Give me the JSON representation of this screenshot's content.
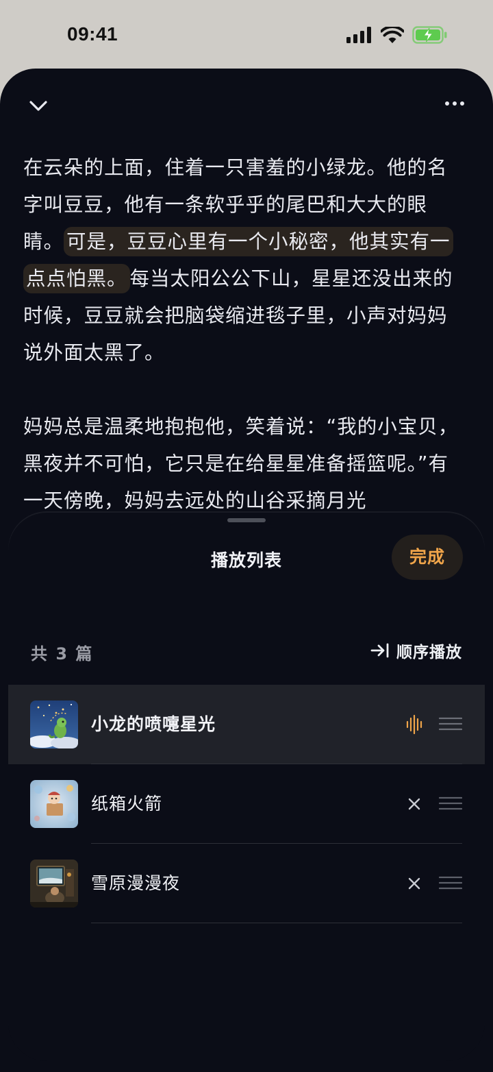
{
  "status_bar": {
    "time": "09:41",
    "icons": [
      "cellular-signal-icon",
      "wifi-icon",
      "battery-charging-icon"
    ],
    "battery_color": "#5ecb4f"
  },
  "reader": {
    "collapse_icon": "chevron-down-icon",
    "more_icon": "more-horizontal-icon",
    "paragraph1": {
      "before": "在云朵的上面，住着一只害羞的小绿龙。他的名字叫豆豆，他有一条软乎乎的尾巴和大大的眼睛。",
      "highlight": "可是，豆豆心里有一个小秘密，他其实有一点点怕黑。",
      "after": "每当太阳公公下山，星星还没出来的时候，豆豆就会把脑袋缩进毯子里，小声对妈妈说外面太黑了。"
    },
    "paragraph2": "妈妈总是温柔地抱抱他，笑着说：“我的小宝贝，黑夜并不可怕，它只是在给星星准备摇篮呢。”有一天傍晚，妈妈去远处的山谷采摘月光"
  },
  "playlist": {
    "title": "播放列表",
    "done_label": "完成",
    "count_label": "共 3 篇",
    "order_label": "顺序播放",
    "order_icon": "arrow-right-to-line-icon",
    "accent_color": "#f0a54a",
    "tracks": [
      {
        "title": "小龙的喷嚏星光",
        "status": "playing",
        "action_icon": "sound-wave-icon",
        "cover": "dragon-starlight-cover"
      },
      {
        "title": "纸箱火箭",
        "status": "queued",
        "action_icon": "close-icon",
        "cover": "box-rocket-cover"
      },
      {
        "title": "雪原漫漫夜",
        "status": "queued",
        "action_icon": "close-icon",
        "cover": "snowfield-night-cover"
      }
    ]
  }
}
